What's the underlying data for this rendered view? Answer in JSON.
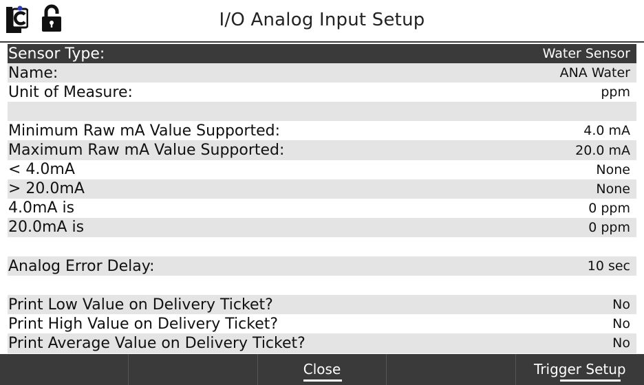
{
  "header": {
    "title": "I/O Analog Input Setup"
  },
  "rows": [
    {
      "label": "Sensor Type:",
      "value": "Water Sensor",
      "selected": true
    },
    {
      "label": "Name:",
      "value": "ANA Water"
    },
    {
      "label": "Unit of Measure:",
      "value": "ppm"
    },
    {
      "label": "",
      "value": ""
    },
    {
      "label": "Minimum Raw mA Value Supported:",
      "value": "4.0 mA"
    },
    {
      "label": "Maximum Raw mA Value Supported:",
      "value": "20.0 mA"
    },
    {
      "label": "< 4.0mA",
      "value": "None"
    },
    {
      "label": "> 20.0mA",
      "value": "None"
    },
    {
      "label": "4.0mA is",
      "value": "0 ppm"
    },
    {
      "label": "20.0mA is",
      "value": "0 ppm"
    },
    {
      "label": "",
      "value": ""
    },
    {
      "label": "Analog Error Delay:",
      "value": "10 sec"
    },
    {
      "label": "",
      "value": ""
    },
    {
      "label": "Print Low Value on Delivery Ticket?",
      "value": "No"
    },
    {
      "label": "Print High Value on Delivery Ticket?",
      "value": "No"
    },
    {
      "label": "Print Average Value on Delivery Ticket?",
      "value": "No"
    }
  ],
  "footer": {
    "buttons": [
      "",
      "",
      "Close",
      "",
      "Trigger Setup"
    ]
  },
  "colors": {
    "selected_row": "#3a3a3a",
    "alt_row": "#e4e4e4",
    "footer": "#3a3a3a",
    "logo_dot": "#2a3cc4"
  },
  "icons": {
    "logo": "lc-logo-icon",
    "lock": "unlocked-padlock-icon"
  }
}
